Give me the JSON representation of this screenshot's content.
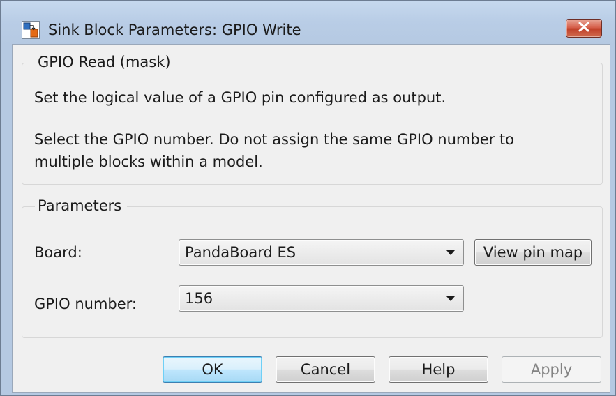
{
  "window": {
    "title": "Sink Block Parameters: GPIO Write",
    "close_glyph": "✕"
  },
  "description_group": {
    "label": "GPIO Read (mask)",
    "line1": "Set the logical value of a GPIO pin configured as output.",
    "line2": "Select the GPIO number. Do not assign the same GPIO number to",
    "line3": "multiple blocks within a model."
  },
  "parameters_group": {
    "label": "Parameters",
    "board_label": "Board:",
    "board_value": "PandaBoard ES",
    "view_pin_map_label": "View pin map",
    "gpio_label": "GPIO number:",
    "gpio_value": "156"
  },
  "buttons": {
    "ok": "OK",
    "cancel": "Cancel",
    "help": "Help",
    "apply": "Apply"
  },
  "icons": {
    "app": "simulink-block-icon",
    "close": "close-icon",
    "dropdown": "chevron-down-icon"
  },
  "colors": {
    "close_button": "#c1412a",
    "default_button_border": "#3c7fb1",
    "window_frame": "#b9cde6",
    "client_background": "#f0f0f0"
  }
}
